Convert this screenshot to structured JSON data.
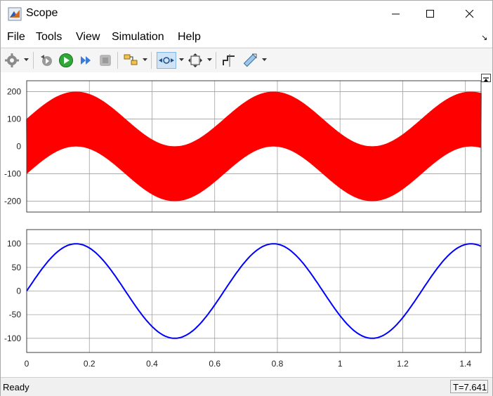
{
  "window": {
    "title": "Scope"
  },
  "menu": {
    "items": [
      {
        "label": "File"
      },
      {
        "label": "Tools"
      },
      {
        "label": "View"
      },
      {
        "label": "Simulation"
      },
      {
        "label": "Help"
      }
    ],
    "undock_glyph": "↘"
  },
  "toolbar": {
    "buttons": [
      {
        "icon": "gear-icon"
      },
      {
        "icon": "step-back-icon"
      },
      {
        "icon": "run-icon"
      },
      {
        "icon": "step-forward-icon"
      },
      {
        "icon": "stop-icon"
      },
      {
        "icon": "highlight-block-icon"
      },
      {
        "icon": "zoom-icon",
        "active": true
      },
      {
        "icon": "autoscale-icon"
      },
      {
        "icon": "cursor-measurements-icon"
      },
      {
        "icon": "measure-icon"
      }
    ]
  },
  "colors": {
    "signal_top": "#ff0000",
    "signal_bottom": "#0000ff",
    "grid": "#a0a0a0"
  },
  "chart_data": [
    {
      "type": "line",
      "description_series": "sine 100 amplitude with dense high-frequency band of ±100",
      "xlim": [
        0,
        1.45
      ],
      "ylim": [
        -240,
        240
      ],
      "yticks": [
        200,
        100,
        0,
        -100,
        -200
      ],
      "xticks": [
        0,
        0.2,
        0.4,
        0.6,
        0.8,
        1,
        1.2,
        1.4
      ],
      "series": [
        {
          "color": "#ff0000",
          "envelope_center_amplitude": 100,
          "envelope_half_width": 100,
          "period": 0.63,
          "phase_offset": 0
        }
      ]
    },
    {
      "type": "line",
      "xlim": [
        0,
        1.45
      ],
      "ylim": [
        -130,
        130
      ],
      "yticks": [
        100,
        50,
        0,
        -50,
        -100
      ],
      "xticks": [
        0,
        0.2,
        0.4,
        0.6,
        0.8,
        1,
        1.2,
        1.4
      ],
      "xtick_labels": [
        "0",
        "0.2",
        "0.4",
        "0.6",
        "0.8",
        "1",
        "1.2",
        "1.4"
      ],
      "series": [
        {
          "color": "#0000ff",
          "amplitude": 100,
          "period": 0.63
        }
      ]
    }
  ],
  "status": {
    "text": "Ready",
    "time": "T=7.641"
  }
}
